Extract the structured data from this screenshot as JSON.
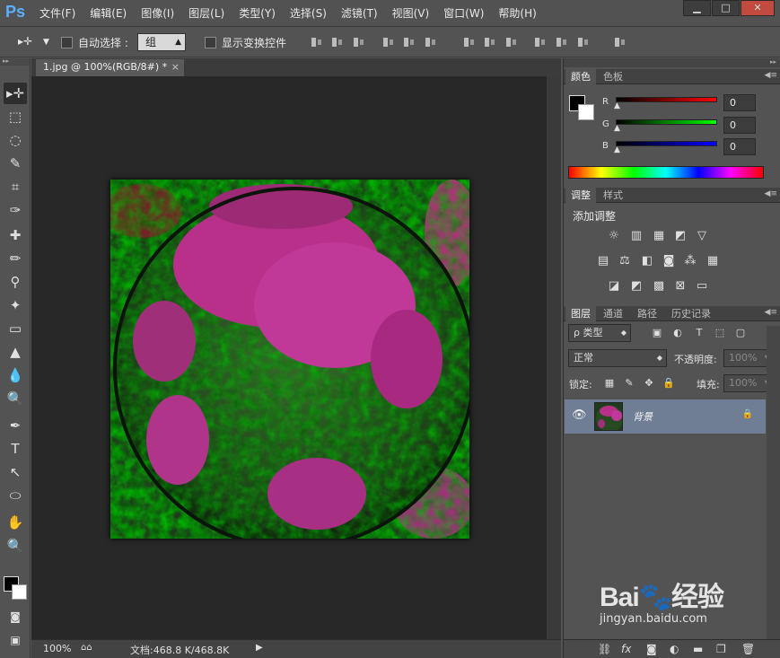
{
  "app": {
    "logo": "Ps"
  },
  "menu": [
    "文件(F)",
    "编辑(E)",
    "图像(I)",
    "图层(L)",
    "类型(Y)",
    "选择(S)",
    "滤镜(T)",
    "视图(V)",
    "窗口(W)",
    "帮助(H)"
  ],
  "window_buttons": {
    "minimize": "▁",
    "restore": "□",
    "close": "✕"
  },
  "options": {
    "move_tool_icon": "▸✛",
    "auto_select_label": "自动选择 :",
    "auto_select_value": "组",
    "show_transform_label": "显示变换控件"
  },
  "document": {
    "tab_label": "1.jpg @ 100%(RGB/8#) *",
    "tab_close": "×",
    "zoom": "100%",
    "doc_size": "文档:468.8 K/468.8K",
    "status_arrow": "▶"
  },
  "tools": [
    "▸✛",
    "⬚",
    "◌",
    "✎",
    "⌗",
    "✑",
    "✚",
    "✏",
    "⚲",
    "✦",
    "▭",
    "▲",
    "💧",
    "🔍",
    "✒",
    "T",
    "↖",
    "⬭",
    "✋",
    "🔍"
  ],
  "panels": {
    "color_tabs": [
      "颜色",
      "色板"
    ],
    "rgb": [
      {
        "label": "R",
        "value": "0"
      },
      {
        "label": "G",
        "value": "0"
      },
      {
        "label": "B",
        "value": "0"
      }
    ],
    "adjust_tabs": [
      "调整",
      "样式"
    ],
    "adjust_title": "添加调整",
    "layers_tabs": [
      "图层",
      "通道",
      "路径",
      "历史记录"
    ],
    "filter_kind": "ρ 类型",
    "blend_mode": "正常",
    "opacity_label": "不透明度:",
    "opacity_value": "100%",
    "lock_label": "锁定:",
    "fill_label": "填充:",
    "fill_value": "100%",
    "layer_name": "背景",
    "eye_icon": "👁",
    "lock_icon": "🔒"
  },
  "watermark": {
    "logo": "Bai🐾经验",
    "url": "jingyan.baidu.com"
  }
}
